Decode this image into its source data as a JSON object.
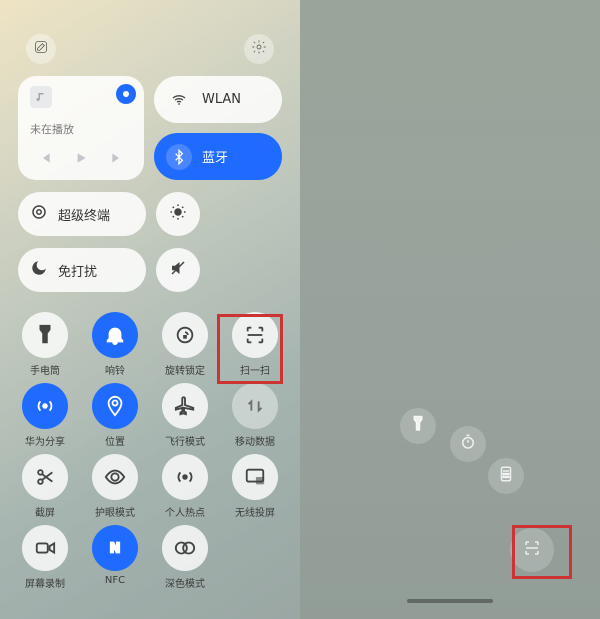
{
  "control_center": {
    "media": {
      "status": "未在播放"
    },
    "pills": {
      "wlan": {
        "label": "WLAN",
        "on": false
      },
      "bluetooth": {
        "label": "蓝牙",
        "on": true
      },
      "super_device": {
        "label": "超级终端"
      },
      "dnd": {
        "label": "免打扰"
      }
    },
    "shortcuts": [
      {
        "id": "flashlight",
        "label": "手电筒",
        "icon": "flashlight-icon",
        "style": "light"
      },
      {
        "id": "ring",
        "label": "响铃",
        "icon": "bell-icon",
        "style": "blue"
      },
      {
        "id": "rotation",
        "label": "旋转锁定",
        "icon": "rotation-lock-icon",
        "style": "light"
      },
      {
        "id": "scan",
        "label": "扫一扫",
        "icon": "scan-icon",
        "style": "light",
        "highlighted": true
      },
      {
        "id": "hw-share",
        "label": "华为分享",
        "icon": "share-icon",
        "style": "blue"
      },
      {
        "id": "location",
        "label": "位置",
        "icon": "location-icon",
        "style": "blue"
      },
      {
        "id": "airplane",
        "label": "飞行模式",
        "icon": "airplane-icon",
        "style": "light"
      },
      {
        "id": "mobile-data",
        "label": "移动数据",
        "icon": "data-icon",
        "style": "dim"
      },
      {
        "id": "screenshot",
        "label": "截屏",
        "icon": "scissors-icon",
        "style": "light"
      },
      {
        "id": "eye-care",
        "label": "护眼模式",
        "icon": "eye-icon",
        "style": "light"
      },
      {
        "id": "hotspot",
        "label": "个人热点",
        "icon": "hotspot-icon",
        "style": "light"
      },
      {
        "id": "cast",
        "label": "无线投屏",
        "icon": "cast-icon",
        "style": "light"
      },
      {
        "id": "record",
        "label": "屏幕录制",
        "icon": "record-icon",
        "style": "light"
      },
      {
        "id": "nfc",
        "label": "NFC",
        "icon": "nfc-icon",
        "style": "blue"
      },
      {
        "id": "dark-mode",
        "label": "深色模式",
        "icon": "dark-mode-icon",
        "style": "light"
      }
    ]
  },
  "lock_screen_shortcuts": {
    "items": [
      {
        "id": "flashlight",
        "icon": "flashlight-icon"
      },
      {
        "id": "timer",
        "icon": "stopwatch-icon"
      },
      {
        "id": "calculator",
        "icon": "calculator-icon"
      },
      {
        "id": "scan",
        "icon": "scan-icon",
        "highlighted": true
      }
    ]
  },
  "colors": {
    "accent": "#1f6bff",
    "highlight": "#cc3333"
  }
}
